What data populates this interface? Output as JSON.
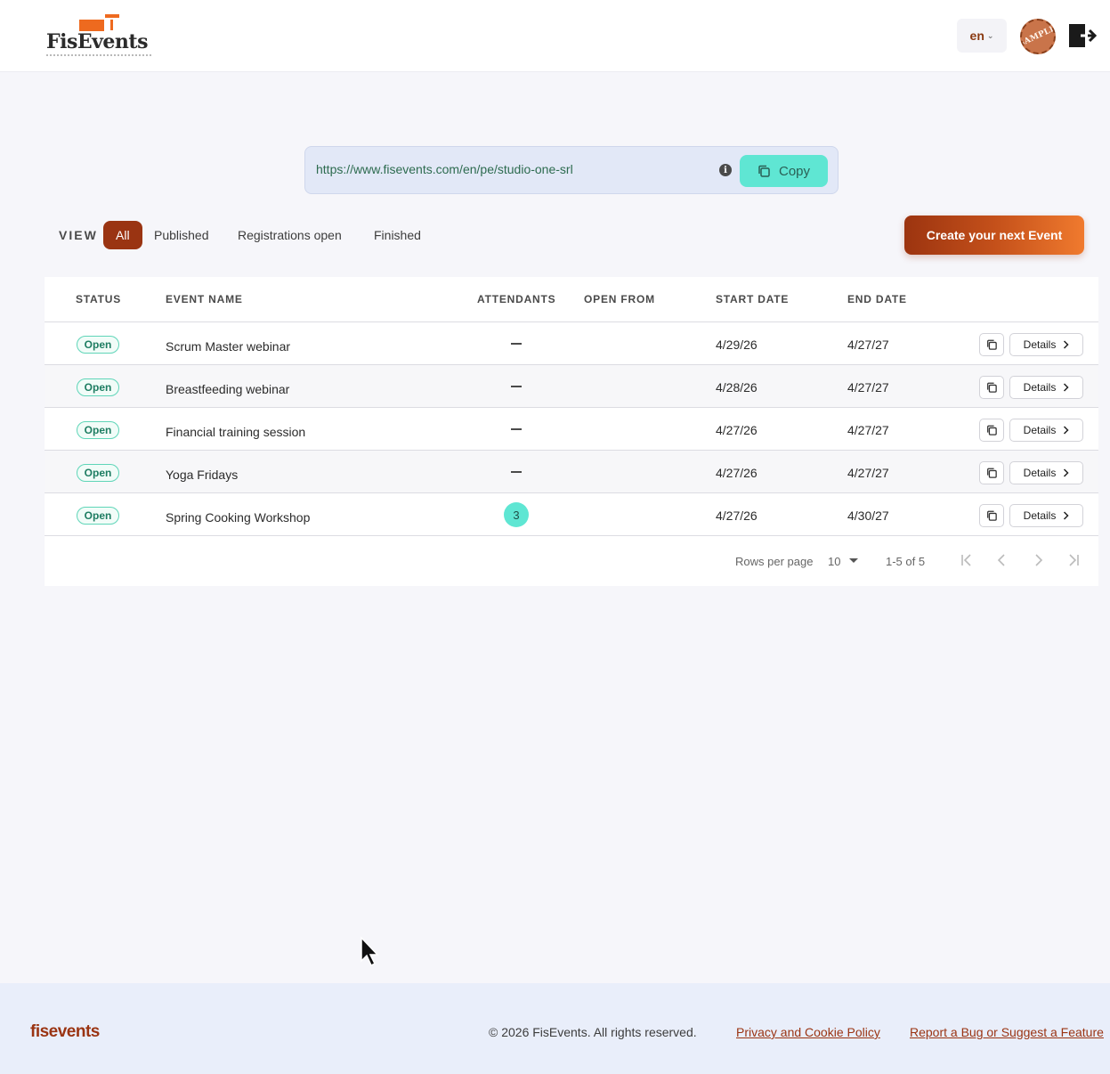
{
  "header": {
    "logo_text": "FisEvents",
    "language": "en",
    "avatar_text": "SAMPLE"
  },
  "share": {
    "url": "https://www.fisevents.com/en/pe/studio-one-srl",
    "info_glyph": "i",
    "copy_label": "Copy"
  },
  "view": {
    "label": "VIEW",
    "filters": [
      "All",
      "Published",
      "Registrations open",
      "Finished"
    ],
    "active_filter": "All"
  },
  "create_button": "Create your next Event",
  "table": {
    "columns": [
      "STATUS",
      "EVENT NAME",
      "ATTENDANTS",
      "OPEN FROM",
      "START DATE",
      "END DATE"
    ],
    "rows": [
      {
        "status": "Open",
        "name": "Scrum Master webinar",
        "attendants": "—",
        "open_from": "",
        "start": "4/29/26",
        "end": "4/27/27",
        "details": "Details"
      },
      {
        "status": "Open",
        "name": "Breastfeeding webinar",
        "attendants": "—",
        "open_from": "",
        "start": "4/28/26",
        "end": "4/27/27",
        "details": "Details"
      },
      {
        "status": "Open",
        "name": "Financial training session",
        "attendants": "—",
        "open_from": "",
        "start": "4/27/26",
        "end": "4/27/27",
        "details": "Details"
      },
      {
        "status": "Open",
        "name": "Yoga Fridays",
        "attendants": "—",
        "open_from": "",
        "start": "4/27/26",
        "end": "4/27/27",
        "details": "Details"
      },
      {
        "status": "Open",
        "name": "Spring Cooking Workshop",
        "attendants": "3",
        "open_from": "",
        "start": "4/27/26",
        "end": "4/30/27",
        "details": "Details"
      }
    ]
  },
  "pagination": {
    "rows_per_page_label": "Rows per page",
    "rows_per_page": "10",
    "range": "1-5 of 5"
  },
  "footer": {
    "logo": "fisevents",
    "copyright": "© 2026 FisEvents. All rights reserved.",
    "privacy_link": "Privacy and Cookie Policy",
    "report_link": "Report a Bug or Suggest a Feature"
  },
  "colors": {
    "brand": "#9a3412",
    "accent_teal": "#5fe6d3",
    "brand_orange": "#ee6a1f"
  }
}
